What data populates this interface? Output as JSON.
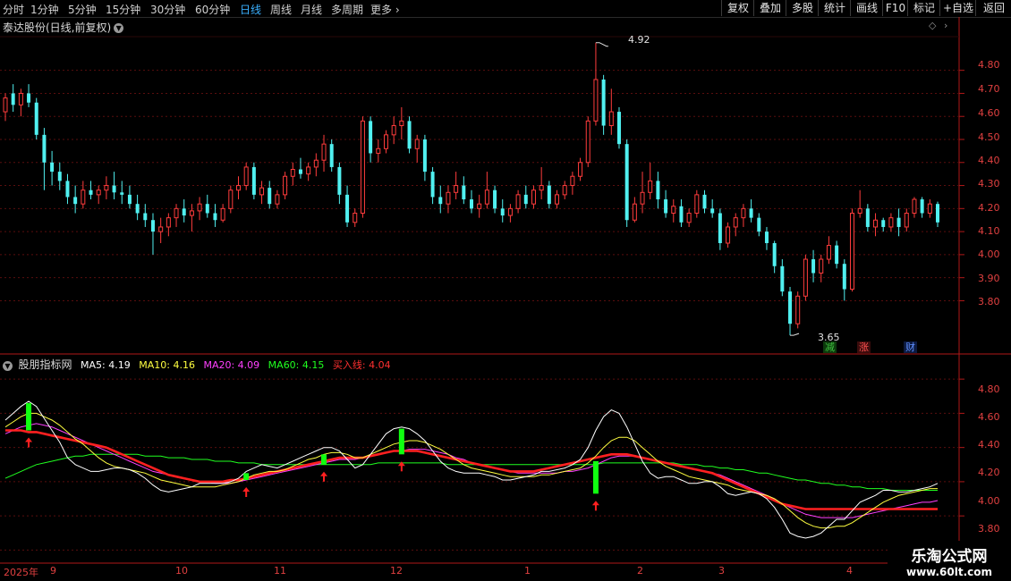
{
  "toolbar": {
    "periods": [
      "分时",
      "1分钟",
      "5分钟",
      "15分钟",
      "30分钟",
      "60分钟",
      "日线",
      "周线",
      "月线",
      "多周期",
      "更多"
    ],
    "active_period": "日线",
    "buttons": [
      "复权",
      "叠加",
      "多股",
      "统计",
      "画线",
      "F10",
      "标记",
      "+自选",
      "返回"
    ]
  },
  "stock_title": "泰达股份(日线,前复权)",
  "indicator": {
    "name": "股朋指标网",
    "ma5": "MA5: 4.19",
    "ma10": "MA10: 4.16",
    "ma20": "MA20: 4.09",
    "ma60": "MA60: 4.15",
    "buy_line": "买入线: 4.04"
  },
  "price_axis": [
    "4.80",
    "4.70",
    "4.60",
    "4.50",
    "4.40",
    "4.30",
    "4.20",
    "4.10",
    "4.00",
    "3.90",
    "3.80"
  ],
  "indicator_axis": [
    "4.80",
    "4.60",
    "4.40",
    "4.20",
    "4.00",
    "3.80"
  ],
  "time_axis": [
    "2025年",
    "9",
    "10",
    "11",
    "12",
    "1",
    "2",
    "3",
    "4"
  ],
  "annotations": {
    "high": "4.92",
    "low": "3.65"
  },
  "badges": [
    {
      "text": "减",
      "color": "#40c040",
      "bg": "#0c3a0c"
    },
    {
      "text": "涨",
      "color": "#ff5050",
      "bg": "#3a0c0c"
    },
    {
      "text": "财",
      "color": "#6090ff",
      "bg": "#0c1a40"
    }
  ],
  "watermark": {
    "name": "乐淘公式网",
    "url": "www.60lt.com"
  },
  "colors": {
    "up": "#ff3c3c",
    "down": "#50f0f0",
    "ma5": "#ffffff",
    "ma10": "#ffff40",
    "ma20": "#ff40ff",
    "ma60": "#20ff20",
    "buy_line": "#ff2020",
    "axis": "#b01818"
  },
  "chart_data": {
    "type": "candlestick",
    "ylim": [
      3.6,
      4.95
    ],
    "candles": [
      [
        4.62,
        4.7,
        4.58,
        4.68
      ],
      [
        4.7,
        4.74,
        4.62,
        4.65
      ],
      [
        4.65,
        4.72,
        4.6,
        4.7
      ],
      [
        4.7,
        4.74,
        4.64,
        4.66
      ],
      [
        4.66,
        4.68,
        4.5,
        4.52
      ],
      [
        4.52,
        4.55,
        4.28,
        4.4
      ],
      [
        4.4,
        4.45,
        4.3,
        4.36
      ],
      [
        4.36,
        4.4,
        4.28,
        4.32
      ],
      [
        4.32,
        4.35,
        4.22,
        4.25
      ],
      [
        4.25,
        4.3,
        4.18,
        4.22
      ],
      [
        4.22,
        4.32,
        4.2,
        4.28
      ],
      [
        4.28,
        4.32,
        4.24,
        4.26
      ],
      [
        4.26,
        4.3,
        4.22,
        4.28
      ],
      [
        4.28,
        4.34,
        4.24,
        4.3
      ],
      [
        4.3,
        4.36,
        4.24,
        4.27
      ],
      [
        4.27,
        4.32,
        4.22,
        4.26
      ],
      [
        4.26,
        4.3,
        4.2,
        4.22
      ],
      [
        4.22,
        4.26,
        4.15,
        4.18
      ],
      [
        4.18,
        4.22,
        4.12,
        4.15
      ],
      [
        4.15,
        4.18,
        4.0,
        4.1
      ],
      [
        4.1,
        4.16,
        4.05,
        4.12
      ],
      [
        4.12,
        4.18,
        4.08,
        4.16
      ],
      [
        4.16,
        4.22,
        4.12,
        4.2
      ],
      [
        4.2,
        4.24,
        4.14,
        4.17
      ],
      [
        4.17,
        4.22,
        4.1,
        4.19
      ],
      [
        4.19,
        4.25,
        4.15,
        4.22
      ],
      [
        4.22,
        4.26,
        4.16,
        4.18
      ],
      [
        4.18,
        4.22,
        4.12,
        4.15
      ],
      [
        4.15,
        4.22,
        4.14,
        4.2
      ],
      [
        4.2,
        4.3,
        4.18,
        4.28
      ],
      [
        4.28,
        4.34,
        4.24,
        4.3
      ],
      [
        4.3,
        4.4,
        4.28,
        4.38
      ],
      [
        4.38,
        4.4,
        4.24,
        4.26
      ],
      [
        4.26,
        4.32,
        4.22,
        4.29
      ],
      [
        4.29,
        4.32,
        4.2,
        4.22
      ],
      [
        4.22,
        4.28,
        4.2,
        4.26
      ],
      [
        4.26,
        4.36,
        4.24,
        4.34
      ],
      [
        4.34,
        4.4,
        4.3,
        4.37
      ],
      [
        4.37,
        4.42,
        4.33,
        4.35
      ],
      [
        4.35,
        4.4,
        4.32,
        4.38
      ],
      [
        4.38,
        4.44,
        4.34,
        4.41
      ],
      [
        4.41,
        4.52,
        4.36,
        4.48
      ],
      [
        4.48,
        4.5,
        4.36,
        4.38
      ],
      [
        4.38,
        4.4,
        4.22,
        4.26
      ],
      [
        4.26,
        4.3,
        4.12,
        4.14
      ],
      [
        4.14,
        4.2,
        4.12,
        4.18
      ],
      [
        4.18,
        4.6,
        4.16,
        4.58
      ],
      [
        4.58,
        4.6,
        4.4,
        4.44
      ],
      [
        4.44,
        4.5,
        4.4,
        4.46
      ],
      [
        4.46,
        4.54,
        4.44,
        4.52
      ],
      [
        4.52,
        4.6,
        4.48,
        4.56
      ],
      [
        4.56,
        4.64,
        4.5,
        4.58
      ],
      [
        4.58,
        4.6,
        4.44,
        4.46
      ],
      [
        4.46,
        4.52,
        4.4,
        4.5
      ],
      [
        4.5,
        4.52,
        4.32,
        4.36
      ],
      [
        4.36,
        4.38,
        4.22,
        4.25
      ],
      [
        4.25,
        4.3,
        4.18,
        4.22
      ],
      [
        4.22,
        4.3,
        4.18,
        4.27
      ],
      [
        4.27,
        4.36,
        4.24,
        4.3
      ],
      [
        4.3,
        4.34,
        4.22,
        4.24
      ],
      [
        4.24,
        4.28,
        4.18,
        4.2
      ],
      [
        4.2,
        4.26,
        4.16,
        4.22
      ],
      [
        4.22,
        4.36,
        4.2,
        4.28
      ],
      [
        4.28,
        4.3,
        4.18,
        4.2
      ],
      [
        4.2,
        4.24,
        4.14,
        4.17
      ],
      [
        4.17,
        4.22,
        4.14,
        4.2
      ],
      [
        4.2,
        4.28,
        4.18,
        4.26
      ],
      [
        4.26,
        4.3,
        4.2,
        4.22
      ],
      [
        4.22,
        4.3,
        4.2,
        4.28
      ],
      [
        4.28,
        4.38,
        4.24,
        4.3
      ],
      [
        4.3,
        4.32,
        4.2,
        4.22
      ],
      [
        4.22,
        4.28,
        4.2,
        4.26
      ],
      [
        4.26,
        4.32,
        4.24,
        4.3
      ],
      [
        4.3,
        4.36,
        4.26,
        4.34
      ],
      [
        4.34,
        4.42,
        4.32,
        4.4
      ],
      [
        4.4,
        4.6,
        4.38,
        4.58
      ],
      [
        4.58,
        4.92,
        4.56,
        4.76
      ],
      [
        4.76,
        4.78,
        4.52,
        4.56
      ],
      [
        4.56,
        4.72,
        4.52,
        4.62
      ],
      [
        4.62,
        4.64,
        4.46,
        4.48
      ],
      [
        4.48,
        4.5,
        4.12,
        4.15
      ],
      [
        4.15,
        4.25,
        4.14,
        4.22
      ],
      [
        4.22,
        4.36,
        4.18,
        4.27
      ],
      [
        4.27,
        4.4,
        4.24,
        4.32
      ],
      [
        4.32,
        4.36,
        4.2,
        4.24
      ],
      [
        4.24,
        4.28,
        4.16,
        4.18
      ],
      [
        4.18,
        4.24,
        4.14,
        4.21
      ],
      [
        4.21,
        4.24,
        4.12,
        4.14
      ],
      [
        4.14,
        4.2,
        4.12,
        4.18
      ],
      [
        4.18,
        4.28,
        4.16,
        4.26
      ],
      [
        4.26,
        4.28,
        4.18,
        4.2
      ],
      [
        4.2,
        4.24,
        4.16,
        4.18
      ],
      [
        4.18,
        4.2,
        4.02,
        4.05
      ],
      [
        4.05,
        4.14,
        4.03,
        4.12
      ],
      [
        4.12,
        4.18,
        4.08,
        4.16
      ],
      [
        4.16,
        4.22,
        4.12,
        4.2
      ],
      [
        4.2,
        4.24,
        4.14,
        4.16
      ],
      [
        4.16,
        4.18,
        4.08,
        4.1
      ],
      [
        4.1,
        4.12,
        4.02,
        4.05
      ],
      [
        4.05,
        4.06,
        3.92,
        3.95
      ],
      [
        3.95,
        3.98,
        3.82,
        3.84
      ],
      [
        3.84,
        3.86,
        3.65,
        3.7
      ],
      [
        3.7,
        3.84,
        3.68,
        3.82
      ],
      [
        3.82,
        4.0,
        3.8,
        3.98
      ],
      [
        3.98,
        4.02,
        3.88,
        3.92
      ],
      [
        3.92,
        4.0,
        3.88,
        3.98
      ],
      [
        3.98,
        4.08,
        3.96,
        4.04
      ],
      [
        4.04,
        4.06,
        3.94,
        3.96
      ],
      [
        3.96,
        3.98,
        3.8,
        3.85
      ],
      [
        3.85,
        4.2,
        3.84,
        4.18
      ],
      [
        4.18,
        4.28,
        4.16,
        4.2
      ],
      [
        4.2,
        4.22,
        4.1,
        4.12
      ],
      [
        4.12,
        4.18,
        4.08,
        4.15
      ],
      [
        4.15,
        4.16,
        4.1,
        4.12
      ],
      [
        4.12,
        4.18,
        4.1,
        4.16
      ],
      [
        4.16,
        4.2,
        4.08,
        4.12
      ],
      [
        4.12,
        4.2,
        4.1,
        4.18
      ],
      [
        4.18,
        4.25,
        4.16,
        4.24
      ],
      [
        4.24,
        4.25,
        4.16,
        4.18
      ],
      [
        4.18,
        4.24,
        4.16,
        4.22
      ],
      [
        4.22,
        4.23,
        4.12,
        4.14
      ]
    ],
    "ma_ylim": [
      3.75,
      4.9
    ],
    "ma5": [
      4.56,
      4.6,
      4.64,
      4.67,
      4.64,
      4.57,
      4.5,
      4.43,
      4.34,
      4.3,
      4.28,
      4.26,
      4.26,
      4.27,
      4.28,
      4.28,
      4.27,
      4.25,
      4.22,
      4.18,
      4.15,
      4.14,
      4.15,
      4.16,
      4.17,
      4.19,
      4.19,
      4.19,
      4.19,
      4.2,
      4.22,
      4.26,
      4.28,
      4.3,
      4.29,
      4.28,
      4.3,
      4.32,
      4.34,
      4.36,
      4.38,
      4.4,
      4.4,
      4.38,
      4.33,
      4.28,
      4.3,
      4.36,
      4.42,
      4.48,
      4.51,
      4.52,
      4.51,
      4.48,
      4.44,
      4.38,
      4.32,
      4.28,
      4.26,
      4.25,
      4.25,
      4.25,
      4.24,
      4.23,
      4.21,
      4.21,
      4.22,
      4.23,
      4.24,
      4.26,
      4.26,
      4.27,
      4.28,
      4.3,
      4.33,
      4.4,
      4.5,
      4.58,
      4.62,
      4.6,
      4.52,
      4.42,
      4.32,
      4.25,
      4.22,
      4.23,
      4.23,
      4.21,
      4.19,
      4.19,
      4.2,
      4.2,
      4.17,
      4.13,
      4.12,
      4.13,
      4.14,
      4.13,
      4.1,
      4.05,
      3.98,
      3.9,
      3.88,
      3.87,
      3.88,
      3.9,
      3.94,
      3.98,
      3.98,
      4.03,
      4.08,
      4.1,
      4.12,
      4.15,
      4.15,
      4.14,
      4.14,
      4.15,
      4.16,
      4.17,
      4.19
    ],
    "ma10": [
      4.52,
      4.55,
      4.58,
      4.6,
      4.6,
      4.58,
      4.56,
      4.53,
      4.49,
      4.45,
      4.42,
      4.38,
      4.34,
      4.31,
      4.29,
      4.28,
      4.27,
      4.26,
      4.25,
      4.23,
      4.21,
      4.2,
      4.19,
      4.18,
      4.17,
      4.17,
      4.17,
      4.17,
      4.18,
      4.19,
      4.2,
      4.22,
      4.24,
      4.25,
      4.26,
      4.26,
      4.27,
      4.29,
      4.31,
      4.33,
      4.34,
      4.36,
      4.37,
      4.37,
      4.36,
      4.34,
      4.34,
      4.36,
      4.38,
      4.4,
      4.42,
      4.43,
      4.44,
      4.44,
      4.43,
      4.41,
      4.39,
      4.36,
      4.33,
      4.3,
      4.28,
      4.27,
      4.26,
      4.25,
      4.24,
      4.23,
      4.23,
      4.23,
      4.23,
      4.24,
      4.24,
      4.25,
      4.26,
      4.27,
      4.28,
      4.31,
      4.35,
      4.4,
      4.44,
      4.46,
      4.46,
      4.44,
      4.4,
      4.36,
      4.32,
      4.29,
      4.27,
      4.25,
      4.23,
      4.22,
      4.21,
      4.2,
      4.19,
      4.18,
      4.16,
      4.15,
      4.14,
      4.13,
      4.12,
      4.1,
      4.07,
      4.03,
      3.99,
      3.96,
      3.94,
      3.93,
      3.93,
      3.94,
      3.94,
      3.96,
      3.99,
      4.02,
      4.05,
      4.08,
      4.1,
      4.12,
      4.13,
      4.14,
      4.15,
      4.16,
      4.16
    ],
    "ma20": [
      4.48,
      4.5,
      4.52,
      4.53,
      4.54,
      4.53,
      4.52,
      4.5,
      4.48,
      4.46,
      4.44,
      4.42,
      4.4,
      4.38,
      4.36,
      4.34,
      4.32,
      4.3,
      4.28,
      4.26,
      4.25,
      4.24,
      4.23,
      4.22,
      4.21,
      4.2,
      4.2,
      4.19,
      4.19,
      4.19,
      4.2,
      4.21,
      4.22,
      4.23,
      4.24,
      4.25,
      4.26,
      4.27,
      4.28,
      4.29,
      4.3,
      4.31,
      4.32,
      4.33,
      4.33,
      4.33,
      4.34,
      4.35,
      4.36,
      4.37,
      4.38,
      4.38,
      4.39,
      4.39,
      4.39,
      4.38,
      4.37,
      4.36,
      4.34,
      4.33,
      4.31,
      4.3,
      4.29,
      4.28,
      4.27,
      4.26,
      4.25,
      4.25,
      4.25,
      4.25,
      4.25,
      4.25,
      4.26,
      4.26,
      4.27,
      4.28,
      4.3,
      4.32,
      4.34,
      4.35,
      4.35,
      4.35,
      4.34,
      4.33,
      4.32,
      4.31,
      4.3,
      4.29,
      4.28,
      4.27,
      4.26,
      4.25,
      4.24,
      4.22,
      4.2,
      4.18,
      4.16,
      4.14,
      4.12,
      4.1,
      4.07,
      4.05,
      4.03,
      4.01,
      4.0,
      3.99,
      3.99,
      3.99,
      3.99,
      3.99,
      4.0,
      4.01,
      4.02,
      4.03,
      4.04,
      4.05,
      4.06,
      4.07,
      4.08,
      4.08,
      4.09
    ],
    "ma60": [
      4.22,
      4.24,
      4.26,
      4.28,
      4.3,
      4.31,
      4.32,
      4.33,
      4.34,
      4.35,
      4.35,
      4.36,
      4.36,
      4.36,
      4.36,
      4.36,
      4.36,
      4.36,
      4.35,
      4.35,
      4.35,
      4.34,
      4.34,
      4.34,
      4.33,
      4.33,
      4.33,
      4.32,
      4.32,
      4.32,
      4.31,
      4.31,
      4.31,
      4.3,
      4.3,
      4.3,
      4.3,
      4.3,
      4.3,
      4.3,
      4.3,
      4.3,
      4.3,
      4.3,
      4.3,
      4.3,
      4.3,
      4.3,
      4.31,
      4.31,
      4.31,
      4.31,
      4.31,
      4.31,
      4.31,
      4.31,
      4.31,
      4.3,
      4.3,
      4.3,
      4.3,
      4.3,
      4.3,
      4.3,
      4.3,
      4.3,
      4.3,
      4.3,
      4.3,
      4.3,
      4.3,
      4.3,
      4.3,
      4.3,
      4.3,
      4.3,
      4.3,
      4.31,
      4.31,
      4.31,
      4.31,
      4.31,
      4.31,
      4.31,
      4.31,
      4.31,
      4.31,
      4.3,
      4.3,
      4.3,
      4.29,
      4.29,
      4.28,
      4.28,
      4.27,
      4.27,
      4.26,
      4.25,
      4.25,
      4.24,
      4.23,
      4.22,
      4.21,
      4.21,
      4.2,
      4.19,
      4.19,
      4.18,
      4.18,
      4.17,
      4.17,
      4.16,
      4.16,
      4.16,
      4.15,
      4.15,
      4.15,
      4.15,
      4.15,
      4.15,
      4.15
    ],
    "buy_line": [
      4.5,
      4.5,
      4.5,
      4.49,
      4.49,
      4.48,
      4.47,
      4.46,
      4.45,
      4.44,
      4.43,
      4.42,
      4.41,
      4.4,
      4.38,
      4.36,
      4.34,
      4.32,
      4.3,
      4.28,
      4.26,
      4.24,
      4.23,
      4.22,
      4.21,
      4.2,
      4.2,
      4.2,
      4.2,
      4.21,
      4.21,
      4.22,
      4.23,
      4.24,
      4.25,
      4.26,
      4.27,
      4.28,
      4.29,
      4.3,
      4.31,
      4.32,
      4.33,
      4.34,
      4.34,
      4.34,
      4.34,
      4.35,
      4.36,
      4.37,
      4.38,
      4.38,
      4.38,
      4.38,
      4.37,
      4.36,
      4.35,
      4.34,
      4.33,
      4.32,
      4.31,
      4.3,
      4.29,
      4.28,
      4.27,
      4.26,
      4.26,
      4.26,
      4.26,
      4.27,
      4.28,
      4.29,
      4.3,
      4.31,
      4.32,
      4.33,
      4.34,
      4.35,
      4.36,
      4.36,
      4.36,
      4.35,
      4.34,
      4.33,
      4.32,
      4.31,
      4.3,
      4.29,
      4.28,
      4.27,
      4.26,
      4.25,
      4.23,
      4.21,
      4.19,
      4.17,
      4.15,
      4.13,
      4.11,
      4.09,
      4.07,
      4.06,
      4.05,
      4.04,
      4.04,
      4.04,
      4.04,
      4.04,
      4.04,
      4.04,
      4.04,
      4.04,
      4.04,
      4.04,
      4.04,
      4.04,
      4.04,
      4.04,
      4.04,
      4.04,
      4.04
    ],
    "signals": [
      {
        "index": 3,
        "top": 4.66,
        "bottom": 4.5
      },
      {
        "index": 31,
        "top": 4.25,
        "bottom": 4.21
      },
      {
        "index": 41,
        "top": 4.36,
        "bottom": 4.3
      },
      {
        "index": 51,
        "top": 4.51,
        "bottom": 4.36
      },
      {
        "index": 76,
        "top": 4.32,
        "bottom": 4.13
      }
    ]
  }
}
